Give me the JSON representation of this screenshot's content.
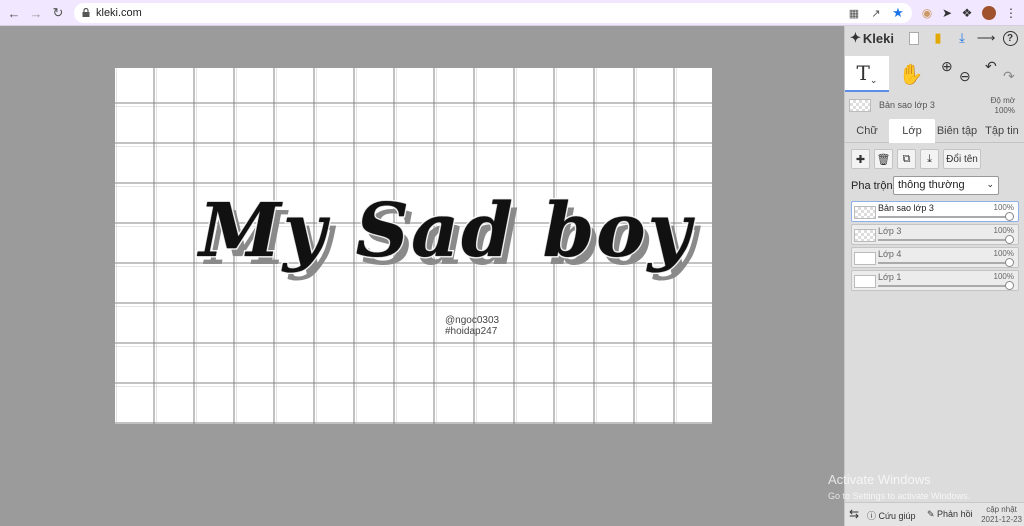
{
  "browser": {
    "url": "kleki.com",
    "back_icon": "arrow-left-icon",
    "forward_icon": "arrow-right-icon",
    "reload_icon": "reload-icon"
  },
  "canvas": {
    "artwork_text": "My Sad boy",
    "tag_user": "@ngoc0303",
    "tag_hash": "#hoidap247"
  },
  "panel": {
    "logo": "Kleki",
    "current_layer_name": "Bản sao lớp 3",
    "opacity_label_line1": "Độ mờ",
    "opacity_label_line2": "100%",
    "tabs": [
      "Chữ",
      "Lớp",
      "Biên tập",
      "Tập tin"
    ],
    "active_tab": "Lớp",
    "rename_label": "Đổi tên",
    "blend_label": "Pha trộn",
    "blend_value": "thông thường",
    "layers": [
      {
        "name": "Bản sao lớp 3",
        "opacity": "100%",
        "selected": true
      },
      {
        "name": "Lớp 3",
        "opacity": "100%",
        "selected": false
      },
      {
        "name": "Lớp 4",
        "opacity": "100%",
        "selected": false
      },
      {
        "name": "Lớp 1",
        "opacity": "100%",
        "selected": false
      }
    ],
    "help_label": "Cứu giúp",
    "feedback_label": "Phản hồi",
    "update_line1": "cập nhật",
    "update_line2": "2021-12-23"
  },
  "windows_watermark": {
    "title": "Activate Windows",
    "subtitle": "Go to Settings to activate Windows."
  }
}
